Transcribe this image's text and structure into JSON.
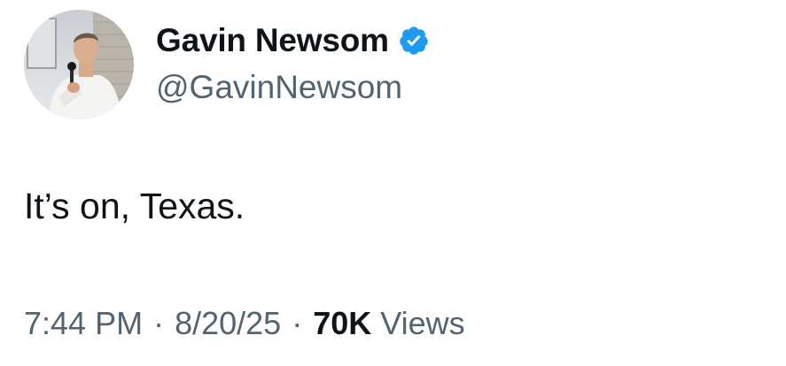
{
  "author": {
    "display_name": "Gavin Newsom",
    "handle": "@GavinNewsom",
    "verified": true,
    "verified_color": "#1d9bf0"
  },
  "tweet": {
    "text": "It’s on, Texas."
  },
  "meta": {
    "time": "7:44 PM",
    "separator": "·",
    "date": "8/20/25",
    "views_count": "70K",
    "views_label": "Views"
  },
  "icons": {
    "verified": "verified-badge-icon"
  },
  "colors": {
    "text_primary": "#0f1419",
    "text_secondary": "#536471",
    "background": "#ffffff"
  }
}
